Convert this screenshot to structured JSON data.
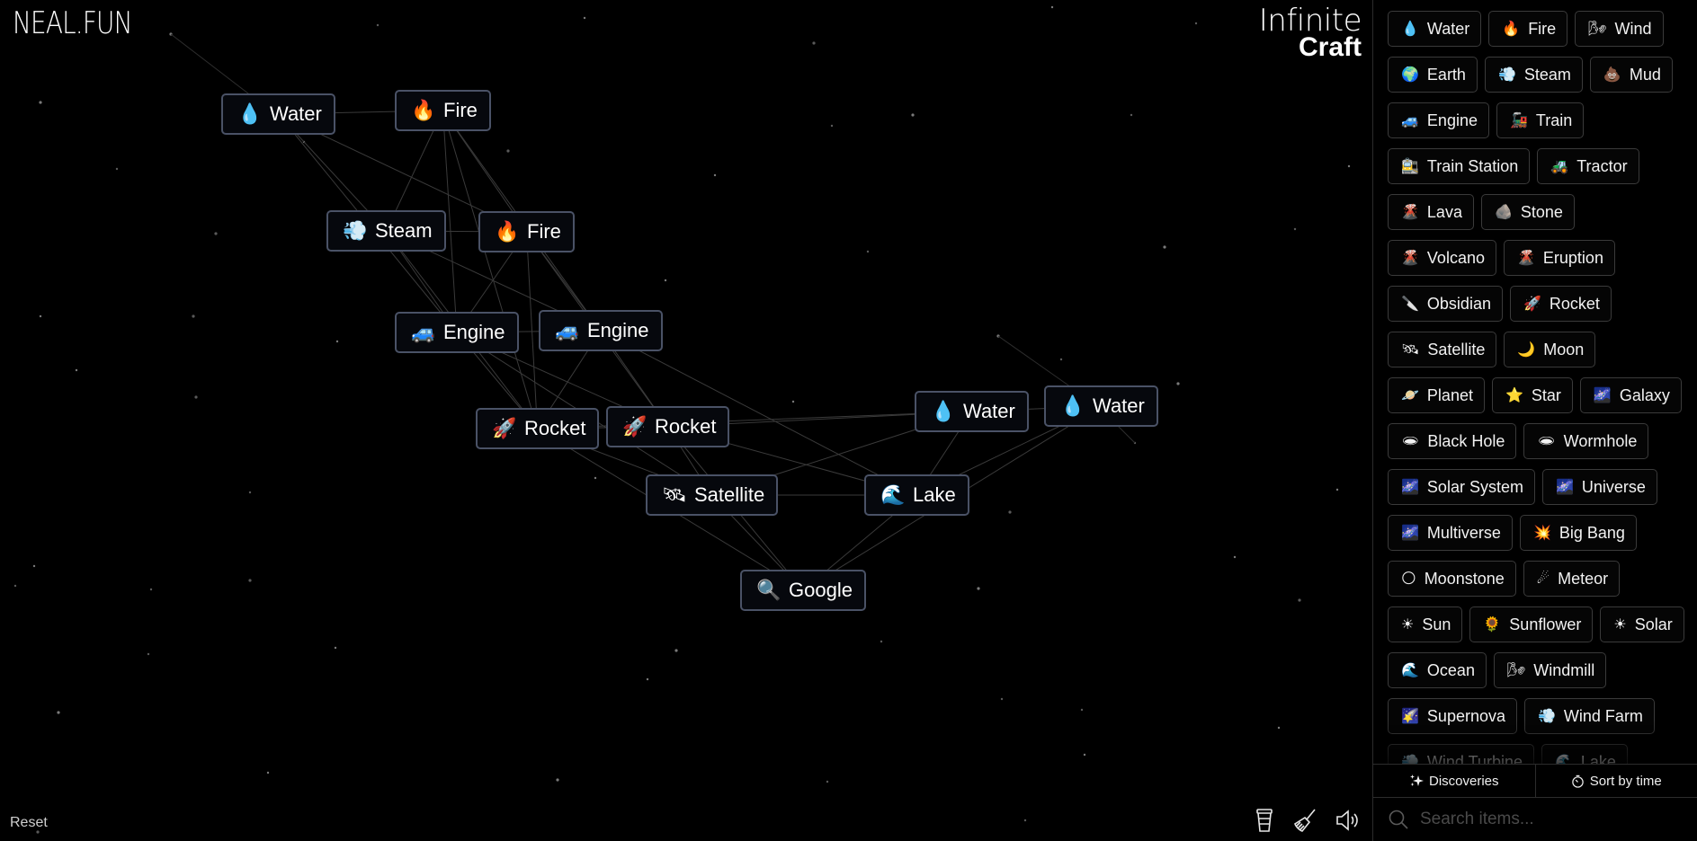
{
  "header": {
    "logo": "NEAL.FUN",
    "brand_line1": "Infinite",
    "brand_line2": "Craft"
  },
  "canvas": {
    "nodes": [
      {
        "id": "water1",
        "label": "Water",
        "icon": "water-drop-icon",
        "emoji": "💧"
      },
      {
        "id": "fire1",
        "label": "Fire",
        "icon": "fire-icon",
        "emoji": "🔥"
      },
      {
        "id": "steam1",
        "label": "Steam",
        "icon": "steam-icon",
        "emoji": "💨"
      },
      {
        "id": "fire2",
        "label": "Fire",
        "icon": "fire-icon",
        "emoji": "🔥"
      },
      {
        "id": "engine1",
        "label": "Engine",
        "icon": "car-icon",
        "emoji": "🚙"
      },
      {
        "id": "engine2",
        "label": "Engine",
        "icon": "car-icon",
        "emoji": "🚙"
      },
      {
        "id": "rocket1",
        "label": "Rocket",
        "icon": "rocket-icon",
        "emoji": "🚀"
      },
      {
        "id": "rocket2",
        "label": "Rocket",
        "icon": "rocket-icon",
        "emoji": "🚀"
      },
      {
        "id": "water2",
        "label": "Water",
        "icon": "water-drop-icon",
        "emoji": "💧"
      },
      {
        "id": "water3",
        "label": "Water",
        "icon": "water-drop-icon",
        "emoji": "💧"
      },
      {
        "id": "satellite1",
        "label": "Satellite",
        "icon": "satellite-icon",
        "emoji": "🛰"
      },
      {
        "id": "lake1",
        "label": "Lake",
        "icon": "wave-icon",
        "emoji": "🌊"
      },
      {
        "id": "google1",
        "label": "Google",
        "icon": "magnifier-icon",
        "emoji": "🔍"
      }
    ],
    "reset_label": "Reset",
    "tools": [
      {
        "name": "coffee-cup-icon"
      },
      {
        "name": "broom-icon"
      },
      {
        "name": "speaker-icon"
      }
    ]
  },
  "sidebar": {
    "items": [
      {
        "label": "Water",
        "emoji": "💧"
      },
      {
        "label": "Fire",
        "emoji": "🔥"
      },
      {
        "label": "Wind",
        "emoji": "🌬"
      },
      {
        "label": "Earth",
        "emoji": "🌍"
      },
      {
        "label": "Steam",
        "emoji": "💨"
      },
      {
        "label": "Mud",
        "emoji": "💩"
      },
      {
        "label": "Engine",
        "emoji": "🚙"
      },
      {
        "label": "Train",
        "emoji": "🚂"
      },
      {
        "label": "Train Station",
        "emoji": "🚉"
      },
      {
        "label": "Tractor",
        "emoji": "🚜"
      },
      {
        "label": "Lava",
        "emoji": "🌋"
      },
      {
        "label": "Stone",
        "emoji": "🪨"
      },
      {
        "label": "Volcano",
        "emoji": "🌋"
      },
      {
        "label": "Eruption",
        "emoji": "🌋"
      },
      {
        "label": "Obsidian",
        "emoji": "🔪"
      },
      {
        "label": "Rocket",
        "emoji": "🚀"
      },
      {
        "label": "Satellite",
        "emoji": "🛰"
      },
      {
        "label": "Moon",
        "emoji": "🌙"
      },
      {
        "label": "Planet",
        "emoji": "🪐"
      },
      {
        "label": "Star",
        "emoji": "⭐"
      },
      {
        "label": "Galaxy",
        "emoji": "🌌"
      },
      {
        "label": "Black Hole",
        "emoji": "🕳"
      },
      {
        "label": "Wormhole",
        "emoji": "🕳"
      },
      {
        "label": "Solar System",
        "emoji": "🌌"
      },
      {
        "label": "Universe",
        "emoji": "🌌"
      },
      {
        "label": "Multiverse",
        "emoji": "🌌"
      },
      {
        "label": "Big Bang",
        "emoji": "💥"
      },
      {
        "label": "Moonstone",
        "emoji": "🌕"
      },
      {
        "label": "Meteor",
        "emoji": "☄"
      },
      {
        "label": "Sun",
        "emoji": "☀"
      },
      {
        "label": "Sunflower",
        "emoji": "🌻"
      },
      {
        "label": "Solar",
        "emoji": "☀"
      },
      {
        "label": "Ocean",
        "emoji": "🌊"
      },
      {
        "label": "Windmill",
        "emoji": "🌬"
      },
      {
        "label": "Supernova",
        "emoji": "🌠"
      },
      {
        "label": "Wind Farm",
        "emoji": "💨"
      },
      {
        "label": "Wind Turbine",
        "emoji": "💨"
      },
      {
        "label": "Lake",
        "emoji": "🌊"
      }
    ],
    "tabs": {
      "discoveries_label": "Discoveries",
      "sort_label": "Sort by time"
    },
    "search": {
      "placeholder": "Search items..."
    }
  }
}
